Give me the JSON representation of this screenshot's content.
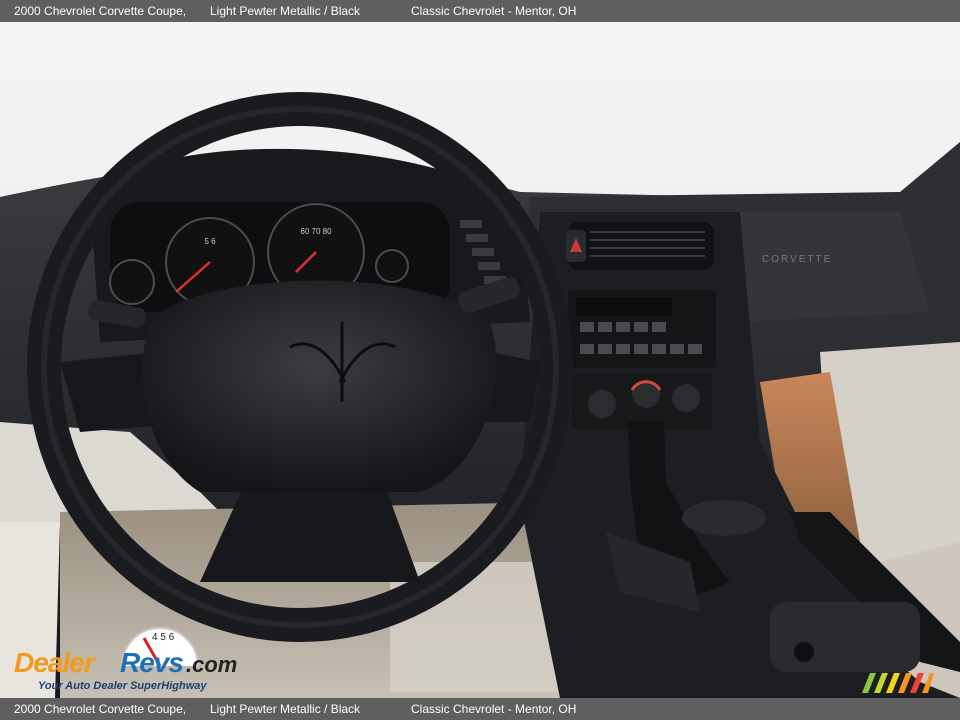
{
  "caption": {
    "vehicle": "2000 Chevrolet Corvette Coupe,",
    "color": "Light Pewter Metallic / Black",
    "dealer": "Classic Chevrolet - Mentor, OH"
  },
  "watermark": {
    "brand": "DealerRevs.com",
    "tagline": "Your Auto Dealer SuperHighway"
  },
  "colors": {
    "caption_bar": "#5f5f5f",
    "dash": "#1e1f22",
    "seat_leather": "#d9d5cf",
    "carpet": "#bdb6aa",
    "logo_orange": "#f39a1b",
    "logo_blue": "#1f6fb8"
  }
}
